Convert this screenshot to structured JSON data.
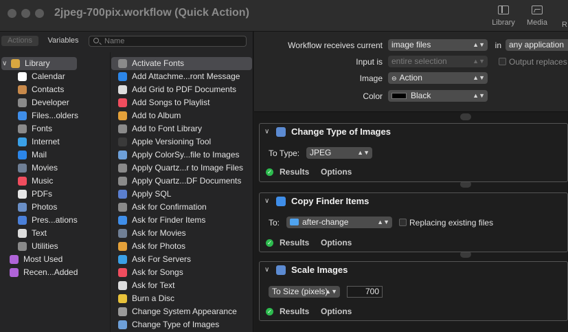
{
  "window": {
    "title": "2jpeg-700pix.workflow (Quick Action)",
    "toolbar": [
      {
        "label": "Library",
        "icon": "library-icon"
      },
      {
        "label": "Media",
        "icon": "media-icon"
      }
    ]
  },
  "library_panel": {
    "tabs": {
      "actions": "Actions",
      "variables": "Variables"
    },
    "search_placeholder": "Name",
    "categories": [
      {
        "label": "Library",
        "icon": "library-books-icon",
        "color": "#d9a740"
      },
      {
        "label": "Calendar",
        "icon": "calendar-icon",
        "color": "#ffffff"
      },
      {
        "label": "Contacts",
        "icon": "contacts-icon",
        "color": "#c8894a"
      },
      {
        "label": "Developer",
        "icon": "developer-tools-icon",
        "color": "#8a8a8a"
      },
      {
        "label": "Files...olders",
        "icon": "finder-icon",
        "color": "#3f8ee9"
      },
      {
        "label": "Fonts",
        "icon": "fonts-icon",
        "color": "#8a8a8a"
      },
      {
        "label": "Internet",
        "icon": "globe-icon",
        "color": "#3aa0e6"
      },
      {
        "label": "Mail",
        "icon": "mail-icon",
        "color": "#2c86e8"
      },
      {
        "label": "Movies",
        "icon": "movies-icon",
        "color": "#6f7f95"
      },
      {
        "label": "Music",
        "icon": "music-icon",
        "color": "#f04d5e"
      },
      {
        "label": "PDFs",
        "icon": "pdf-icon",
        "color": "#e6e6e6"
      },
      {
        "label": "Photos",
        "icon": "photos-icon",
        "color": "#6a8fc7"
      },
      {
        "label": "Pres...ations",
        "icon": "presentations-icon",
        "color": "#4a7fd8"
      },
      {
        "label": "Text",
        "icon": "text-icon",
        "color": "#dddddd"
      },
      {
        "label": "Utilities",
        "icon": "utilities-icon",
        "color": "#8a8a8a"
      },
      {
        "label": "Most Used",
        "icon": "smart-folder-icon",
        "color": "#b064d8"
      },
      {
        "label": "Recen...Added",
        "icon": "smart-folder-icon",
        "color": "#b064d8"
      }
    ],
    "actions": [
      {
        "label": "Activate Fonts",
        "icon": "fonts-icon",
        "color": "#8a8a8a"
      },
      {
        "label": "Add Attachme...ront Message",
        "icon": "mail-icon",
        "color": "#2c86e8"
      },
      {
        "label": "Add Grid to PDF Documents",
        "icon": "pdf-icon",
        "color": "#dddddd"
      },
      {
        "label": "Add Songs to Playlist",
        "icon": "music-icon",
        "color": "#f04d5e"
      },
      {
        "label": "Add to Album",
        "icon": "photos-icon",
        "color": "#e4a13a"
      },
      {
        "label": "Add to Font Library",
        "icon": "fonts-icon",
        "color": "#8a8a8a"
      },
      {
        "label": "Apple Versioning Tool",
        "icon": "terminal-icon",
        "color": "#3a3a3a"
      },
      {
        "label": "Apply ColorSy...file to Images",
        "icon": "preview-icon",
        "color": "#6d9fd8"
      },
      {
        "label": "Apply Quartz...r to Image Files",
        "icon": "developer-tools-icon",
        "color": "#8a8a8a"
      },
      {
        "label": "Apply Quartz...DF Documents",
        "icon": "developer-tools-icon",
        "color": "#8a8a8a"
      },
      {
        "label": "Apply SQL",
        "icon": "sql-icon",
        "color": "#5a7fd0"
      },
      {
        "label": "Ask for Confirmation",
        "icon": "automator-icon",
        "color": "#8a8a8a"
      },
      {
        "label": "Ask for Finder Items",
        "icon": "finder-icon",
        "color": "#3f8ee9"
      },
      {
        "label": "Ask for Movies",
        "icon": "movies-icon",
        "color": "#6f7f95"
      },
      {
        "label": "Ask for Photos",
        "icon": "photos-icon",
        "color": "#e4a13a"
      },
      {
        "label": "Ask For Servers",
        "icon": "globe-icon",
        "color": "#3aa0e6"
      },
      {
        "label": "Ask for Songs",
        "icon": "music-icon",
        "color": "#f04d5e"
      },
      {
        "label": "Ask for Text",
        "icon": "text-icon",
        "color": "#dddddd"
      },
      {
        "label": "Burn a Disc",
        "icon": "burn-icon",
        "color": "#e8c23a"
      },
      {
        "label": "Change System Appearance",
        "icon": "appearance-icon",
        "color": "#9a9a9a"
      },
      {
        "label": "Change Type of Images",
        "icon": "preview-icon",
        "color": "#6d9fd8"
      }
    ]
  },
  "workflow_input": {
    "receives_label": "Workflow receives current",
    "receives_value": "image files",
    "in_label": "in",
    "in_value": "any application",
    "input_is_label": "Input is",
    "input_is_value": "entire selection",
    "output_replaces_label": "Output replaces",
    "image_label": "Image",
    "image_value": "Action",
    "color_label": "Color",
    "color_value": "Black",
    "color_swatch": "#000000"
  },
  "actions": [
    {
      "title": "Change Type of Images",
      "icon": "preview-icon",
      "field_label": "To Type:",
      "field_value": "JPEG",
      "results_label": "Results",
      "options_label": "Options"
    },
    {
      "title": "Copy Finder Items",
      "icon": "finder-icon",
      "field_label": "To:",
      "field_value": "after-change",
      "replacing_label": "Replacing existing files",
      "results_label": "Results",
      "options_label": "Options"
    },
    {
      "title": "Scale Images",
      "icon": "preview-icon",
      "field_value": "To Size (pixels)",
      "size_value": "700",
      "results_label": "Results",
      "options_label": "Options"
    }
  ]
}
